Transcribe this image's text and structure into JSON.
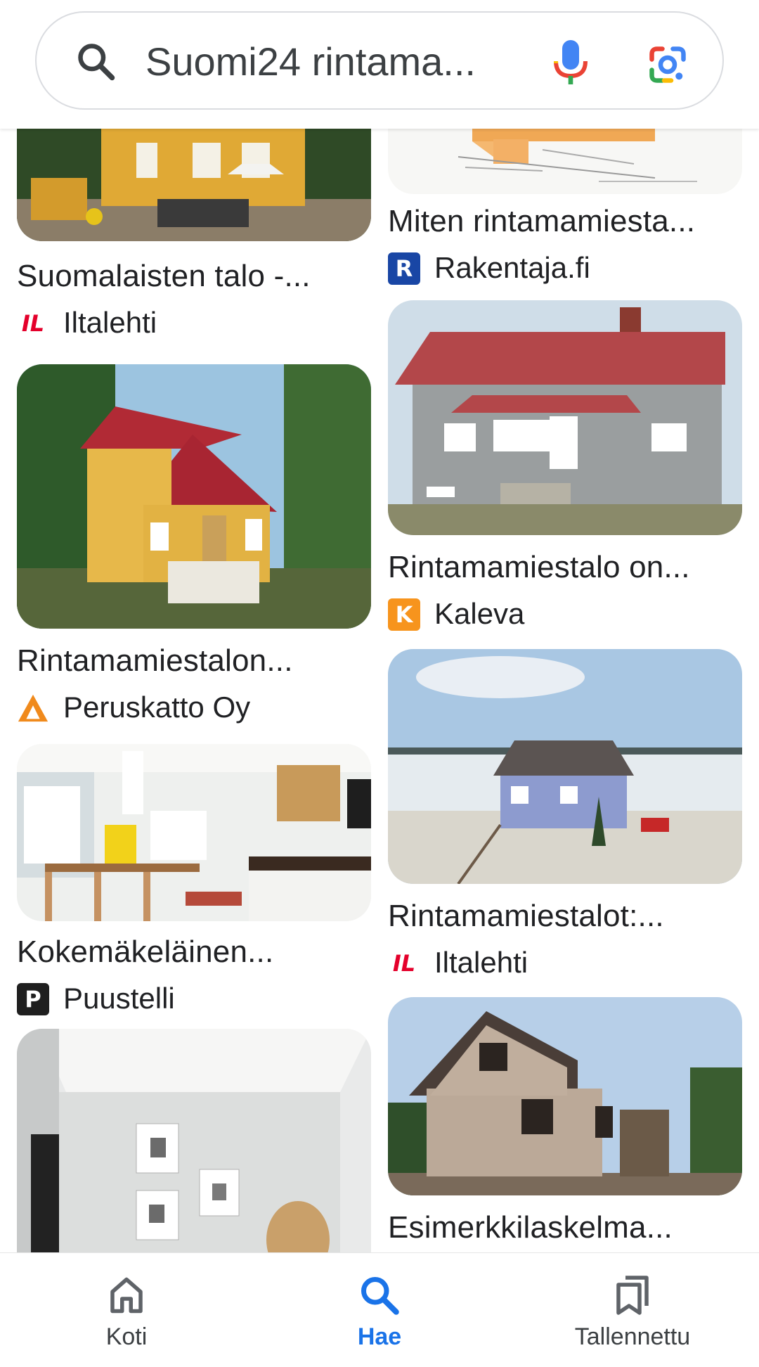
{
  "search": {
    "query": "Suomi24 rintama...",
    "icons": {
      "search": "search-icon",
      "voice": "microphone-icon",
      "lens": "google-lens-icon"
    }
  },
  "results": {
    "left": [
      {
        "title": "Suomalaisten talo -...",
        "source": "Iltalehti",
        "source_logo_text": "IL",
        "logo_color": "#e4002b"
      },
      {
        "title": "Rintamamiestalon...",
        "source": "Peruskatto Oy",
        "source_logo_text": "",
        "logo_color": "#f08a1c"
      },
      {
        "title": "Kokemäkeläinen...",
        "source": "Puustelli",
        "source_logo_text": "P",
        "logo_color": "#1f1f1f"
      },
      {
        "title": "",
        "source": "",
        "source_logo_text": "",
        "logo_color": ""
      }
    ],
    "right": [
      {
        "title": "Miten rintamamiesta...",
        "source": "Rakentaja.fi",
        "source_logo_text": "R",
        "logo_color": "#1946a5"
      },
      {
        "title": "Rintamamiestalo on...",
        "source": "Kaleva",
        "source_logo_text": "K",
        "logo_color": "#f7941d"
      },
      {
        "title": "Rintamamiestalot:...",
        "source": "Iltalehti",
        "source_logo_text": "IL",
        "logo_color": "#e4002b"
      },
      {
        "title": "Esimerkkilaskelma...",
        "source": "",
        "source_logo_text": "",
        "logo_color": ""
      }
    ]
  },
  "nav": {
    "home": {
      "label": "Koti",
      "icon": "home-icon"
    },
    "search": {
      "label": "Hae",
      "icon": "search-icon",
      "active": true
    },
    "saved": {
      "label": "Tallennettu",
      "icon": "bookmarks-icon"
    }
  },
  "colors": {
    "accent": "#1a73e8",
    "text": "#202124"
  }
}
